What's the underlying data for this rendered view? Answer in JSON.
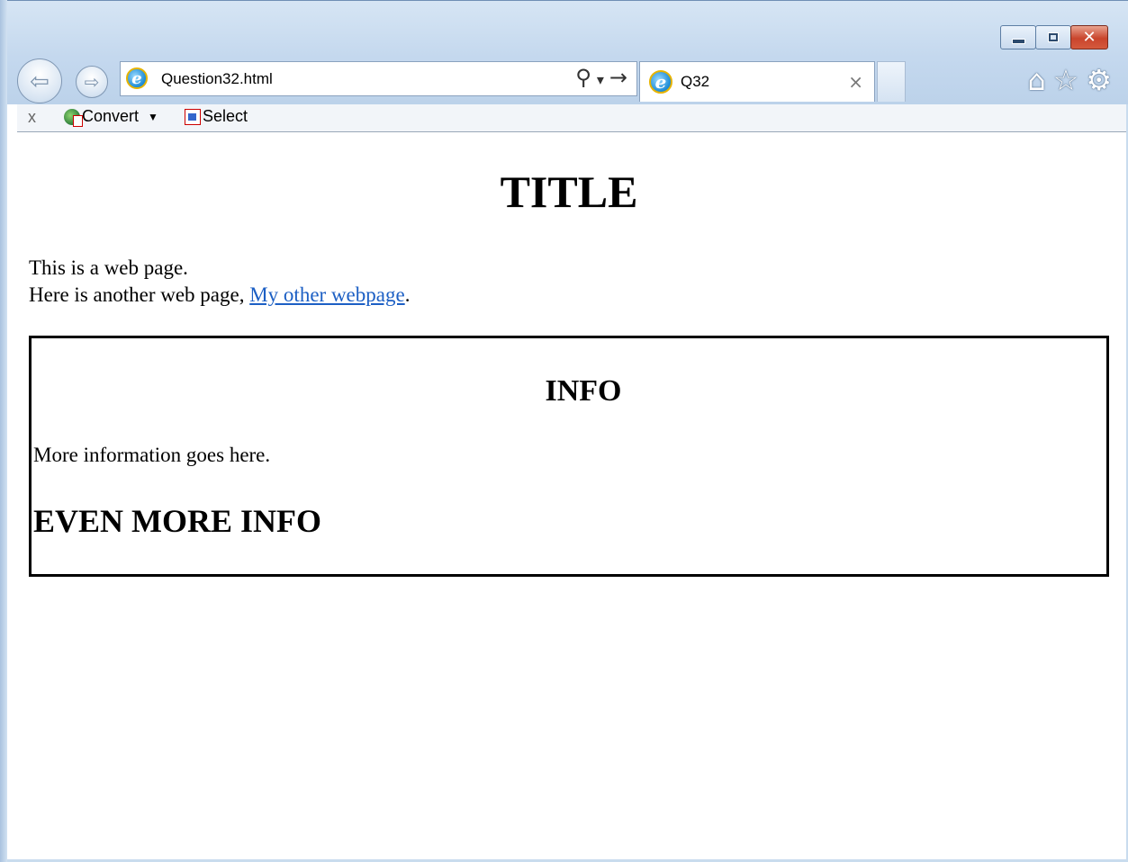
{
  "browser": {
    "address": "Question32.html",
    "tab_title": "Q32",
    "tab_close": "×",
    "window_close": "✕",
    "back_arrow": "⇦",
    "forward_arrow": "⇨",
    "search_glyph": "⚲",
    "dropdown_glyph": "▾",
    "go_glyph": "→",
    "home_glyph": "⌂",
    "favorites_glyph": "☆",
    "settings_glyph": "⚙"
  },
  "command_bar": {
    "close_label": "x",
    "convert_label": "Convert",
    "convert_caret": "▼",
    "select_label": "Select"
  },
  "page": {
    "title": "TITLE",
    "line1": "This is a web page.",
    "line2_before": "Here is another web page, ",
    "link_text": "My other webpage",
    "line2_after": ".",
    "info_heading": "INFO",
    "info_text": "More information goes here.",
    "more_heading": "EVEN MORE INFO"
  },
  "colors": {
    "link": "#1c5fc4",
    "frame": "#c4d8ee",
    "close_button": "#c9442c"
  }
}
